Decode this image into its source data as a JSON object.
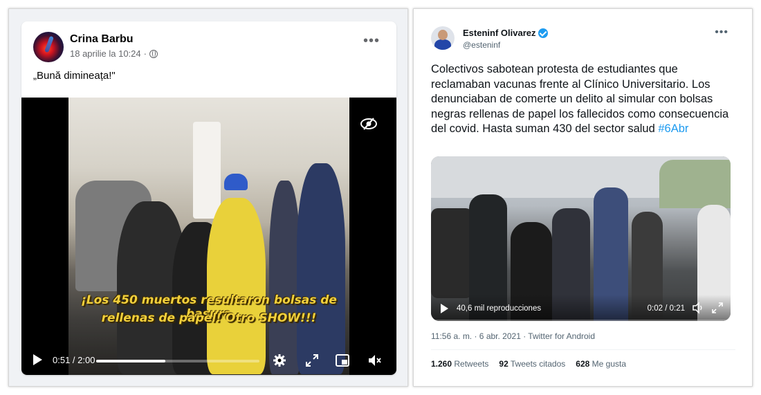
{
  "facebook": {
    "author": "Crina Barbu",
    "date": "18 aprilie la 10:24",
    "separator": "·",
    "more": "•••",
    "text": "„Bună dimineața!\"",
    "video": {
      "caption_line1": "¡Los 450 muertos resultaron bolsas de basura",
      "caption_line2": "rellenas de papel! Otro SHOW!!!",
      "time": "0:51 / 2:00",
      "progress": 0.425
    }
  },
  "twitter": {
    "name": "Esteninf Olivarez",
    "handle": "@esteninf",
    "more": "•••",
    "text": "Colectivos sabotean protesta de estudiantes que reclamaban vacunas frente al Clínico Universitario. Los denunciaban de comerte un delito al simular con bolsas negras rellenas de papel los fallecidos como consecuencia del covid. Hasta suman 430 del sector salud",
    "hashtag": "#6Abr",
    "video": {
      "views": "40,6 mil reproducciones",
      "time": "0:02 / 0:21"
    },
    "timestamp": "11:56 a. m. · 6 abr. 2021 · Twitter for Android",
    "stats": [
      {
        "count": "1.260",
        "label": "Retweets"
      },
      {
        "count": "92",
        "label": "Tweets citados"
      },
      {
        "count": "628",
        "label": "Me gusta"
      }
    ]
  },
  "colors": {
    "fb_background": "#f0f2f5",
    "caption_yellow": "#f2d03c",
    "twitter_blue": "#1d9bf0"
  }
}
